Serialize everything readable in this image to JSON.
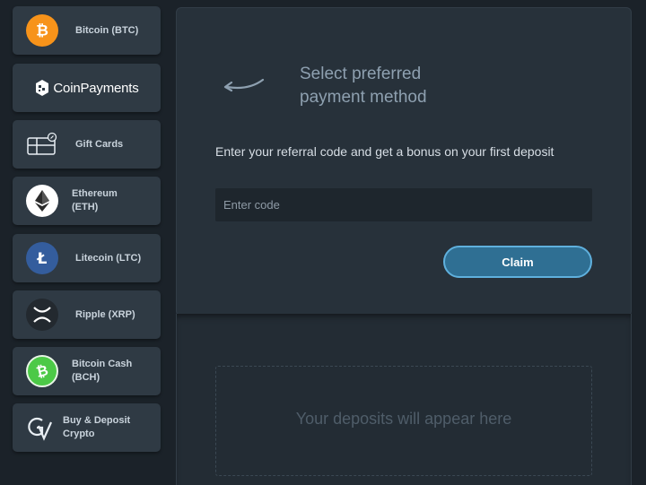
{
  "sidebar": {
    "items": [
      {
        "label": "Bitcoin (BTC)",
        "icon": "bitcoin-icon",
        "color": "#f7931a"
      },
      {
        "label": "CoinPayments",
        "icon": "coinpayments-logo"
      },
      {
        "label": "Gift Cards",
        "icon": "gift-card-icon"
      },
      {
        "label_line1": "Ethereum",
        "label_line2": "(ETH)",
        "icon": "ethereum-icon",
        "color": "#ffffff"
      },
      {
        "label": "Litecoin (LTC)",
        "icon": "litecoin-icon",
        "color": "#345d9d"
      },
      {
        "label": "Ripple (XRP)",
        "icon": "ripple-icon",
        "color": "#23292f"
      },
      {
        "label_line1": "Bitcoin Cash",
        "label_line2": "(BCH)",
        "icon": "bitcoin-cash-icon",
        "color": "#4cc947"
      },
      {
        "label_line1": "Buy & Deposit",
        "label_line2": "Crypto",
        "icon": "buy-crypto-icon"
      }
    ]
  },
  "main": {
    "heading_line1": "Select preferred",
    "heading_line2": "payment method",
    "referral_text": "Enter your referral code and get a bonus on your first deposit",
    "code_placeholder": "Enter code",
    "claim_label": "Claim",
    "deposits_empty": "Your deposits will appear here"
  },
  "colors": {
    "accent": "#2f6f93",
    "accent_border": "#5fb0dd",
    "background": "#1b2229",
    "panel": "#27313a"
  }
}
